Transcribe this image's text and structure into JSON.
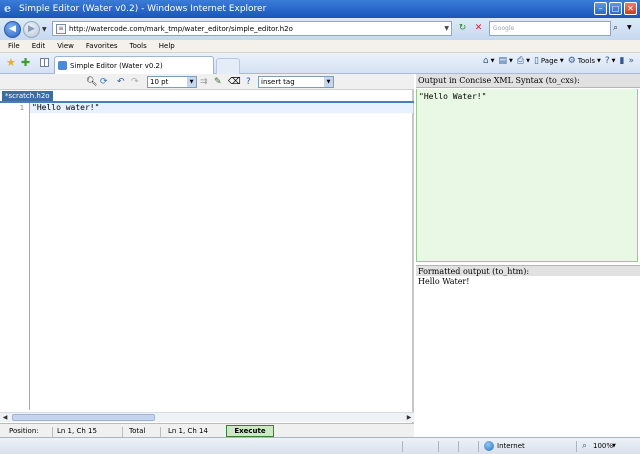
{
  "window": {
    "title": "Simple Editor (Water v0.2) - Windows Internet Explorer",
    "minimize": "–",
    "maximize": "□",
    "close": "✕"
  },
  "addressbar": {
    "url": "http://watercode.com/mark_tmp/water_editor/simple_editor.h2o",
    "search_placeholder": "Google"
  },
  "menu": [
    "File",
    "Edit",
    "View",
    "Favorites",
    "Tools",
    "Help"
  ],
  "tab": {
    "label": "Simple Editor (Water v0.2)"
  },
  "command_bar": {
    "page_label": "Page",
    "tools_label": "Tools"
  },
  "editor": {
    "font_size": "10 pt",
    "tag_select": "insert tag",
    "file_tab": "*scratch.h2o",
    "line_number": "1",
    "code_line": "\"Hello water!\""
  },
  "status": {
    "position_label": "Position:",
    "position_value": "Ln 1, Ch 15",
    "total_label": "Total",
    "total_value": "Ln 1, Ch 14",
    "execute_label": "Execute"
  },
  "output": {
    "cxs_header": "Output in Concise XML Syntax (to_cxs):",
    "cxs_text": "\"Hello Water!\"",
    "htm_header": "Formatted output (to_htm):",
    "htm_text": "Hello Water!"
  },
  "ie_status": {
    "zone": "Internet",
    "zoom": "100%"
  },
  "colors": {
    "titlebar": "#1a56b8",
    "execute_bg": "#cfe8c4",
    "cxs_bg": "#e8f8e4"
  }
}
